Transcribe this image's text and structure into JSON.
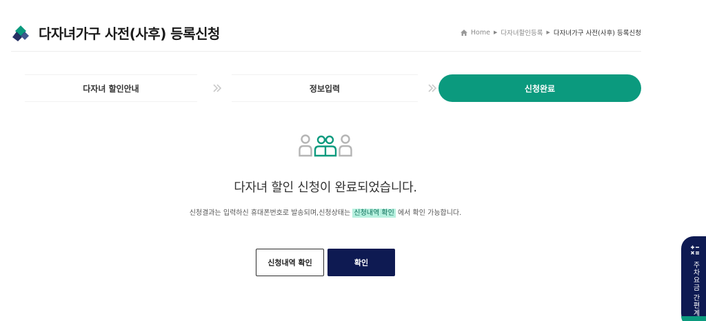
{
  "header": {
    "title": "다자녀가구 사전(사후) 등록신청",
    "breadcrumb": {
      "home": "Home",
      "parent": "다자녀할인등록",
      "current": "다자녀가구 사전(사후) 등록신청"
    }
  },
  "steps": [
    {
      "label": "다자녀 할인안내",
      "active": false
    },
    {
      "label": "정보입력",
      "active": false
    },
    {
      "label": "신청완료",
      "active": true
    }
  ],
  "result": {
    "message": "다자녀 할인 신청이 완료되었습니다.",
    "info_before": "신청결과는 입력하신 휴대폰번호로 발송되며,신청상태는 ",
    "info_highlight": "신청내역 확인",
    "info_after": " 에서 확인 가능합니다."
  },
  "buttons": {
    "history": "신청내역 확인",
    "confirm": "확인"
  },
  "side_widget": {
    "label": "주차요금 간편계산"
  },
  "colors": {
    "accent_green": "#0b9a7e",
    "navy": "#0e1a52",
    "highlight_bg": "#b6f0de"
  },
  "icons": {
    "logo": "brand-logo",
    "home": "home-icon",
    "step_arrow": "double-chevron-right-icon",
    "result": "family-people-icon",
    "calculator": "calculator-icon"
  }
}
